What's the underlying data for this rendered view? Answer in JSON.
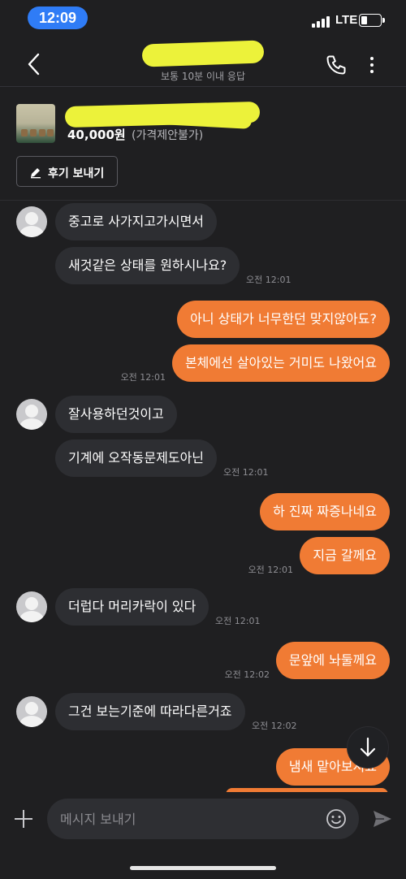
{
  "status_bar": {
    "time": "12:09",
    "network": "LTE",
    "status_color": "#2f7cf6"
  },
  "header": {
    "subtitle": "보통 10분 이내 응답",
    "icons": [
      "back-chevron-icon",
      "phone-icon",
      "more-vertical-icon"
    ]
  },
  "product": {
    "price": "40,000원",
    "price_note": "(가격제안불가)",
    "review_button": "후기 보내기"
  },
  "colors": {
    "sent_bubble": "#f07b34",
    "received_bubble": "#2d2e32",
    "background": "#1f1f21"
  },
  "messages": [
    {
      "side": "recv",
      "text": "중고로 사가지고가시면서",
      "time": ""
    },
    {
      "side": "recv",
      "text": "새것같은 상태를 원하시나요?",
      "time": "오전 12:01"
    },
    {
      "side": "sent",
      "text": "아니 상태가 너무한던 맞지않아됴?",
      "time": ""
    },
    {
      "side": "sent",
      "text": "본체에선 살아있는 거미도 나왔어요",
      "time": "오전 12:01"
    },
    {
      "side": "recv",
      "text": "잘사용하던것이고",
      "time": ""
    },
    {
      "side": "recv",
      "text": "기계에 오작동문제도아닌",
      "time": "오전 12:01"
    },
    {
      "side": "sent",
      "text": "하 진짜 짜증나네요",
      "time": ""
    },
    {
      "side": "sent",
      "text": "지금 갈께요",
      "time": "오전 12:01"
    },
    {
      "side": "recv",
      "text": "더럽다 머리카락이 있다",
      "time": "오전 12:01"
    },
    {
      "side": "sent",
      "text": "문앞에 놔둘께요",
      "time": "오전 12:02"
    },
    {
      "side": "recv",
      "text": "그건 보는기준에 따라다른거죠",
      "time": "오전 12:02"
    },
    {
      "side": "sent",
      "text": "냄새 맡아보시죠",
      "time": ""
    }
  ],
  "composer": {
    "placeholder": "메시지 보내기"
  }
}
